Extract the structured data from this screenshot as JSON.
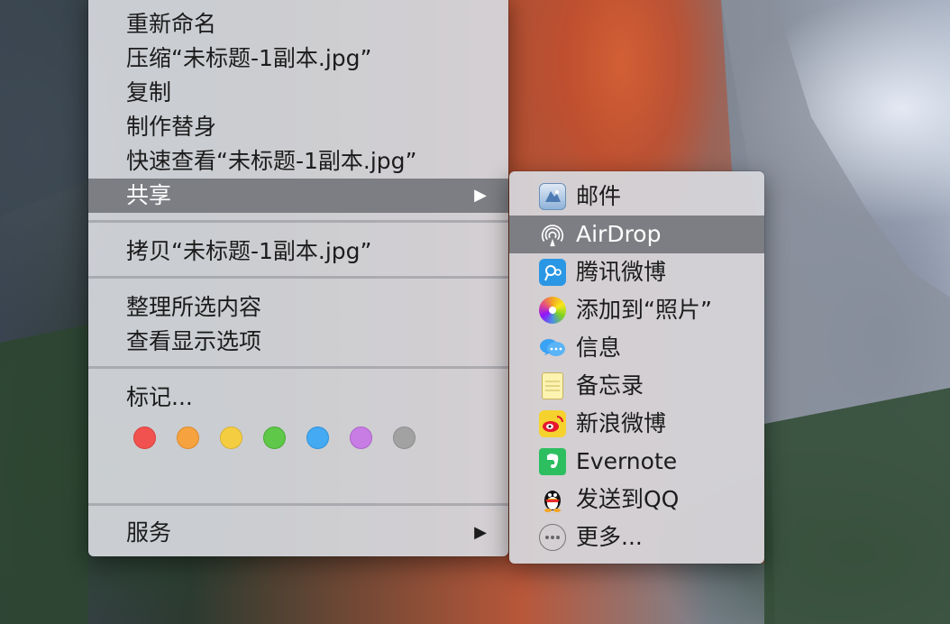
{
  "context_menu": {
    "items": [
      {
        "label": "重新命名"
      },
      {
        "label": "压缩“未标题-1副本.jpg”"
      },
      {
        "label": "复制"
      },
      {
        "label": "制作替身"
      },
      {
        "label": "快速查看“未标题-1副本.jpg”"
      },
      {
        "label": "共享",
        "highlighted": true,
        "has_submenu": true
      },
      {
        "label": "拷贝“未标题-1副本.jpg”"
      },
      {
        "label": "整理所选内容"
      },
      {
        "label": "查看显示选项"
      },
      {
        "label": "标记..."
      },
      {
        "label": "服务",
        "has_submenu": true
      }
    ],
    "submenu_arrow": "▶",
    "tag_colors": [
      "#f2524f",
      "#f6a23e",
      "#f5cd41",
      "#5fc848",
      "#43aaf3",
      "#c77de3",
      "#a2a2a2"
    ]
  },
  "share_submenu": {
    "items": [
      {
        "label": "邮件",
        "icon": "mail-icon"
      },
      {
        "label": "AirDrop",
        "icon": "airdrop-icon",
        "highlighted": true
      },
      {
        "label": "腾讯微博",
        "icon": "tencent-weibo-icon"
      },
      {
        "label": "添加到“照片”",
        "icon": "photos-icon"
      },
      {
        "label": "信息",
        "icon": "messages-icon"
      },
      {
        "label": "备忘录",
        "icon": "notes-icon"
      },
      {
        "label": "新浪微博",
        "icon": "sina-weibo-icon"
      },
      {
        "label": "Evernote",
        "icon": "evernote-icon"
      },
      {
        "label": "发送到QQ",
        "icon": "qq-icon"
      },
      {
        "label": "更多...",
        "icon": "more-icon"
      }
    ]
  }
}
